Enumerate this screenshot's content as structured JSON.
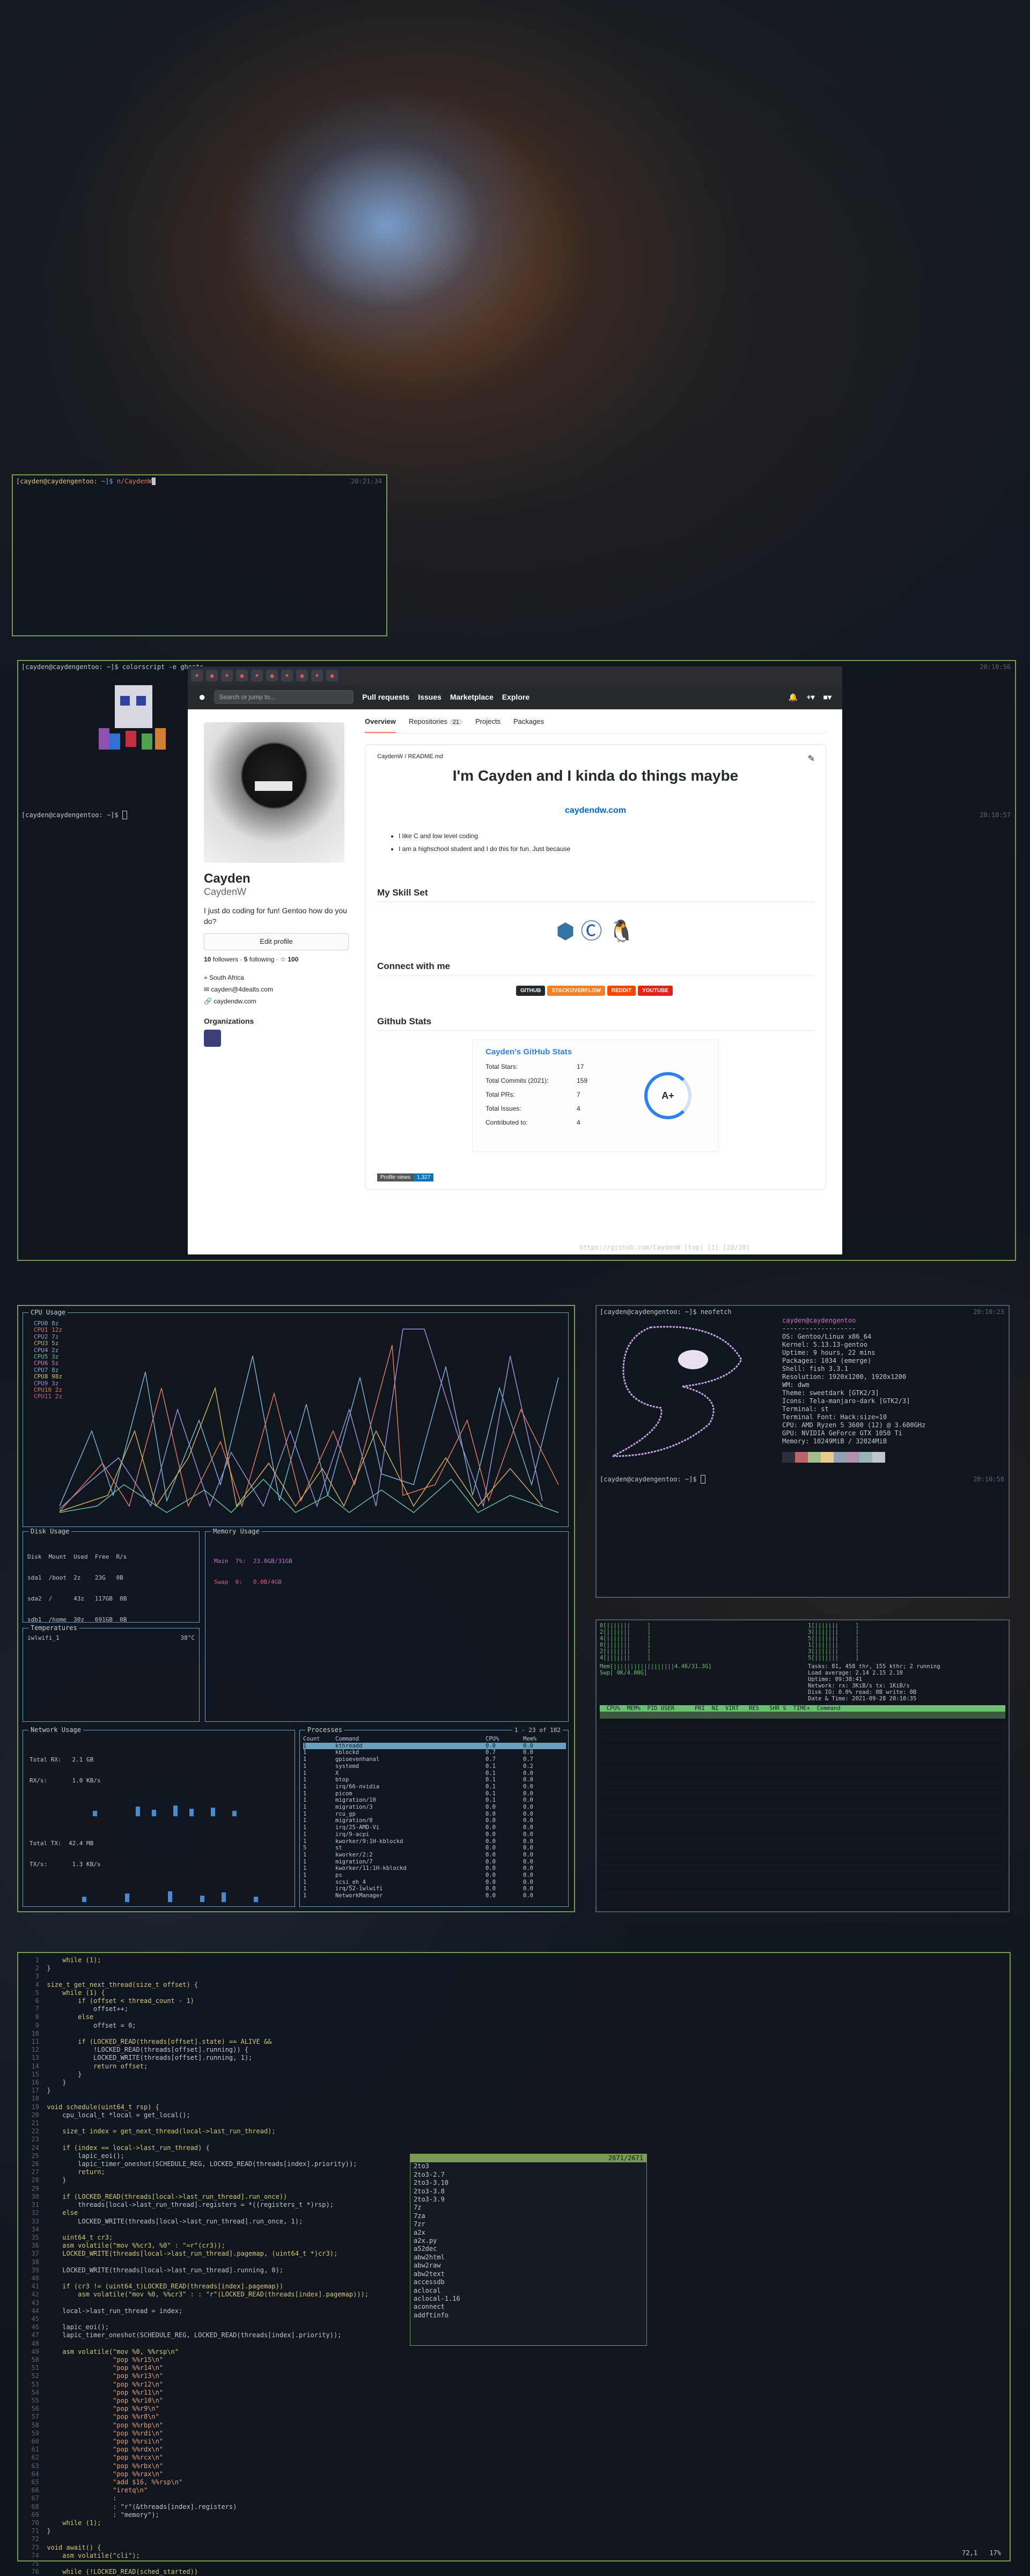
{
  "colors": {
    "accent": "#7a9a55",
    "term_border": "#7a9a55",
    "github_header": "#24292e",
    "link": "#0366d6",
    "btop_border": "#6aa0c0"
  },
  "term1": {
    "user": "[cayden@caydengentoo:",
    "path": " ~]$ ",
    "cmd": "n/CaydenW",
    "time": "20:21:34"
  },
  "term2": {
    "line1": "[cayden@caydengentoo: ~]$ colorscript -e ",
    "line1b": "ghosts",
    "time1": "20:10:56",
    "prompt2": "[cayden@caydengentoo: ~]$ ",
    "time2": "20:10:57"
  },
  "browser": {
    "status": "https://github.com/CaydenW [top] [1] [28/28]",
    "nav": {
      "search_placeholder": "Search or jump to...",
      "items": [
        "Pull requests",
        "Issues",
        "Marketplace",
        "Explore"
      ]
    },
    "profile": {
      "name": "Cayden",
      "username": "CaydenW",
      "bio": "I just do coding for fun! Gentoo how do you do?",
      "edit": "Edit profile",
      "followers": "10",
      "followers_label": "followers",
      "following": "5",
      "following_label": "following",
      "stars": "100",
      "location": "South Africa",
      "email": "cayden@4dealts.com",
      "site": "caydendw.com",
      "orgs_title": "Organizations"
    },
    "tabs": [
      "Overview",
      "Repositories",
      "Projects",
      "Packages"
    ],
    "repo_count": "21",
    "readme": {
      "path": "CaydenW / README.md",
      "title": "I'm Cayden and I kinda do things maybe",
      "link": "caydendw.com",
      "bullets": [
        "I like C and low level coding",
        "I am a highschool student and I do this for fun. Just because"
      ],
      "skills": "My Skill Set",
      "connect": "Connect with me",
      "badges": [
        "GITHUB",
        "STACKOVERFLOW",
        "REDDIT",
        "YOUTUBE"
      ],
      "stats": "Github Stats",
      "stats_card_title": "Cayden's GitHub Stats",
      "stats_rows": [
        {
          "k": "Total Stars:",
          "v": "17"
        },
        {
          "k": "Total Commits (2021):",
          "v": "159"
        },
        {
          "k": "Total PRs:",
          "v": "7"
        },
        {
          "k": "Total Issues:",
          "v": "4"
        },
        {
          "k": "Contributed to:",
          "v": "4"
        }
      ],
      "grade": "A+",
      "views_label": "Profile views",
      "views": "1,327"
    }
  },
  "btop": {
    "cpu_label": "CPU Usage",
    "cpus": [
      "CPU0 8z",
      "CPU1 12z",
      "CPU2 7z",
      "CPU3 5z",
      "CPU4 2z",
      "CPU5 3z",
      "CPU6 5z",
      "CPU7 8z",
      "CPU8 98z",
      "CPU9 3z",
      "CPU10 2z",
      "CPU11 2z"
    ],
    "disk_label": "Disk Usage",
    "disk_header": "Disk  Mount  Used  Free  R/s",
    "disks": [
      "sda1  /boot  2z    23G   0B",
      "sda2  /      43z   117GB  0B",
      "sdb1  /home  30z   691GB  0B"
    ],
    "mem_label": "Memory Usage",
    "mem_main": "Main  7%:  23.0GB/31GB",
    "mem_swap": "Swap  0:   0.0B/4GB",
    "temp_label": "Temperatures",
    "temp_name": "iwlwifi_1",
    "temp_val": "38°C",
    "net_label": "Network Usage",
    "rx": "Total RX:   2.1 GB",
    "rxs": "RX/s:       1.0 KB/s",
    "tx": "Total TX:  42.4 MB",
    "txs": "TX/s:       1.3 KB/s",
    "proc_label": "Processes",
    "proc_range": "1 - 23 of 182",
    "proc_header": [
      "Count",
      "Command",
      "CPU%",
      "Mem%"
    ],
    "procs": [
      [
        "1",
        "kthreadd",
        "0.0",
        "0.0"
      ],
      [
        "1",
        "kblockd",
        "0.7",
        "0.0"
      ],
      [
        "1",
        "gpioevenhanal",
        "0.7",
        "0.7"
      ],
      [
        "1",
        "systemd",
        "0.1",
        "0.2"
      ],
      [
        "1",
        "X",
        "0.1",
        "0.0"
      ],
      [
        "1",
        "btop",
        "0.1",
        "0.0"
      ],
      [
        "1",
        "irq/66-nvidia",
        "0.1",
        "0.0"
      ],
      [
        "1",
        "picom",
        "0.1",
        "0.0"
      ],
      [
        "1",
        "migration/10",
        "0.1",
        "0.0"
      ],
      [
        "1",
        "migration/3",
        "0.0",
        "0.0"
      ],
      [
        "1",
        "rcu_gp",
        "0.0",
        "0.0"
      ],
      [
        "1",
        "migration/0",
        "0.0",
        "0.0"
      ],
      [
        "1",
        "irq/25-AMD-Vi",
        "0.0",
        "0.0"
      ],
      [
        "1",
        "irq/9-acpi",
        "0.0",
        "0.0"
      ],
      [
        "1",
        "kworker/9:1H-kblockd",
        "0.0",
        "0.0"
      ],
      [
        "5",
        "st",
        "0.0",
        "0.0"
      ],
      [
        "1",
        "kworker/2:2",
        "0.0",
        "0.0"
      ],
      [
        "1",
        "migration/7",
        "0.0",
        "0.0"
      ],
      [
        "1",
        "kworker/11:1H-kblockd",
        "0.0",
        "0.0"
      ],
      [
        "1",
        "ps",
        "0.0",
        "0.0"
      ],
      [
        "1",
        "scsi_eh_4",
        "0.0",
        "0.0"
      ],
      [
        "1",
        "irq/52-iwlwifi",
        "0.0",
        "0.0"
      ],
      [
        "1",
        "NetworkManager",
        "0.0",
        "0.0"
      ]
    ]
  },
  "neofetch": {
    "prompt": "[cayden@caydengentoo: ~]$ neofetch",
    "time": "20:10:23",
    "title": "cayden@caydengentoo",
    "sep": "-------------------",
    "info": [
      "OS: Gentoo/Linux x86_64",
      "Kernel: 5.13.13-gentoo",
      "Uptime: 9 hours, 22 mins",
      "Packages: 1034 (emerge)",
      "Shell: fish 3.3.1",
      "Resolution: 1920x1200, 1920x1200",
      "WM: dwm",
      "Theme: sweetdark [GTK2/3]",
      "Icons: Tela-manjaro-dark [GTK2/3]",
      "Terminal: st",
      "Terminal Font: Hack:size=10",
      "CPU: AMD Ryzen 5 3600 (12) @ 3.600GHz",
      "GPU: NVIDIA GeForce GTX 1050 Ti",
      "Memory: 10249MiB / 32024MiB"
    ],
    "prompt2": "[cayden@caydengentoo: ~]$ ",
    "time2": "20:10:58"
  },
  "htop": {
    "tasks": "Tasks: 81, 458 thr, 155 kthr; 2 running",
    "load": "Load average: 2.14 2.15 2.10",
    "uptime": "Uptime: 09:38:41",
    "network": "Network: rx: 3KiB/s tx: 1KiB/s",
    "disk": "Disk IO: 0.0% read: 0B write: 0B",
    "date": "Date & Time: 2021-09-28 20:10:35",
    "mem": "Mem[||||||||||||||||||4.46/31.3G]",
    "swp": "Swp[                      0K/4.00G]",
    "header": "  CPU%  MEM%  PID USER      PRI  NI  VIRT   RES   SHR S  TIME+  Command"
  },
  "editor": {
    "pos": "72,1",
    "pct": "17%",
    "popup_header": "2671/2671",
    "popup_items": [
      "2to3",
      "2to3-2.7",
      "2to3-3.10",
      "2to3-3.8",
      "2to3-3.9",
      "7z",
      "7za",
      "7zr",
      "a2x",
      "a2x.py",
      "a52dec",
      "abw2html",
      "abw2raw",
      "abw2text",
      "accessdb",
      "aclocal",
      "aclocal-1.16",
      "aconnect",
      "addftinfo"
    ],
    "lines": [
      "    while (1);",
      "}",
      "",
      "size_t get_next_thread(size_t offset) {",
      "    while (1) {",
      "        if (offset < thread_count - 1)",
      "            offset++;",
      "        else",
      "            offset = 0;",
      "",
      "        if (LOCKED_READ(threads[offset].state) == ALIVE &&",
      "            !LOCKED_READ(threads[offset].running)) {",
      "            LOCKED_WRITE(threads[offset].running, 1);",
      "            return offset;",
      "        }",
      "    }",
      "}",
      "",
      "void schedule(uint64_t rsp) {",
      "    cpu_local_t *local = get_local();",
      "",
      "    size_t index = get_next_thread(local->last_run_thread);",
      "",
      "    if (index == local->last_run_thread) {",
      "        lapic_eoi();",
      "        lapic_timer_oneshot(SCHEDULE_REG, LOCKED_READ(threads[index].priority));",
      "        return;",
      "    }",
      "",
      "    if (LOCKED_READ(threads[local->last_run_thread].run_once))",
      "        threads[local->last_run_thread].registers = *((registers_t *)rsp);",
      "    else",
      "        LOCKED_WRITE(threads[local->last_run_thread].run_once, 1);",
      "",
      "    uint64_t cr3;",
      "    asm volatile(\"mov %%cr3, %0\" : \"=r\"(cr3));",
      "    LOCKED_WRITE(threads[local->last_run_thread].pagemap, (uint64_t *)cr3);",
      "",
      "    LOCKED_WRITE(threads[local->last_run_thread].running, 0);",
      "",
      "    if (cr3 != (uint64_t)LOCKED_READ(threads[index].pagemap))",
      "        asm volatile(\"mov %0, %%cr3\" : : \"r\"(LOCKED_READ(threads[index].pagemap)));",
      "",
      "    local->last_run_thread = index;",
      "",
      "    lapic_eoi();",
      "    lapic_timer_oneshot(SCHEDULE_REG, LOCKED_READ(threads[index].priority));",
      "",
      "    asm volatile(\"mov %0, %%rsp\\n\"",
      "                 \"pop %%r15\\n\"",
      "                 \"pop %%r14\\n\"",
      "                 \"pop %%r13\\n\"",
      "                 \"pop %%r12\\n\"",
      "                 \"pop %%r11\\n\"",
      "                 \"pop %%r10\\n\"",
      "                 \"pop %%r9\\n\"",
      "                 \"pop %%r8\\n\"",
      "                 \"pop %%rbp\\n\"",
      "                 \"pop %%rdi\\n\"",
      "                 \"pop %%rsi\\n\"",
      "                 \"pop %%rdx\\n\"",
      "                 \"pop %%rcx\\n\"",
      "                 \"pop %%rbx\\n\"",
      "                 \"pop %%rax\\n\"",
      "                 \"add $16, %%rsp\\n\"",
      "                 \"iretq\\n\"",
      "                 :",
      "                 : \"r\"(&threads[index].registers)",
      "                 : \"memory\");",
      "    while (1);",
      "}",
      "",
      "void await() {",
      "    asm volatile(\"cli\");",
      "",
      "    while (!LOCKED_READ(sched_started))"
    ]
  }
}
